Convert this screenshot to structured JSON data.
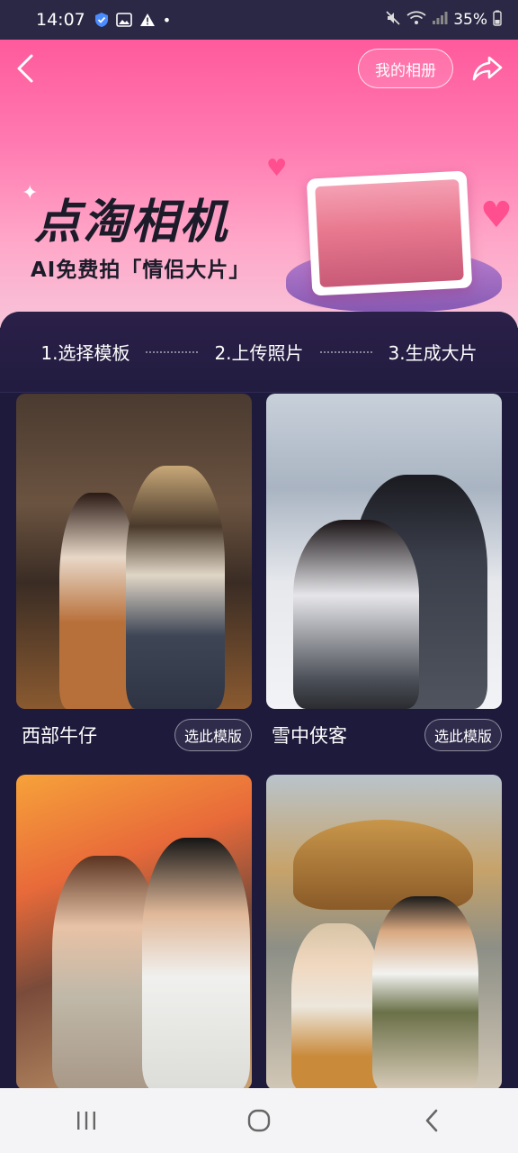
{
  "status_bar": {
    "time": "14:07",
    "battery": "35%"
  },
  "header": {
    "album_label": "我的相册"
  },
  "banner": {
    "title": "点淘相机",
    "subtitle": "AI免费拍「情侣大片」"
  },
  "steps": [
    {
      "label": "1.选择模板"
    },
    {
      "label": "2.上传照片"
    },
    {
      "label": "3.生成大片"
    }
  ],
  "templates": [
    {
      "name": "西部牛仔",
      "action": "选此模版"
    },
    {
      "name": "雪中侠客",
      "action": "选此模版"
    },
    {
      "name": "",
      "action": ""
    },
    {
      "name": "",
      "action": ""
    }
  ],
  "colors": {
    "banner_pink": "#ff5a9c",
    "panel_bg": "#1e1a3c"
  }
}
